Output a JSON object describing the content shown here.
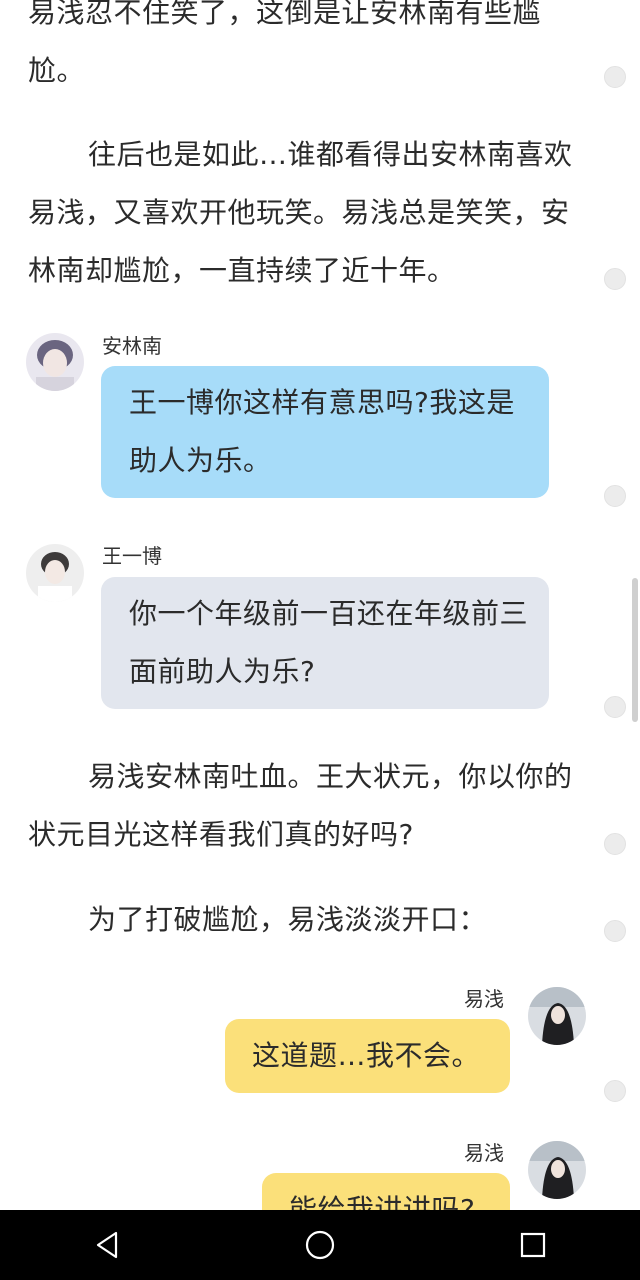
{
  "story": {
    "p1": "易浅忍不住笑了，这倒是让安林南有些尴尬。",
    "p2": "往后也是如此…谁都看得出安林南喜欢易浅，又喜欢开他玩笑。易浅总是笑笑，安林南却尴尬，一直持续了近十年。",
    "p3": "易浅安林南吐血。王大状元，你以你的状元目光这样看我们真的好吗?",
    "p4": "为了打破尴尬，易浅淡淡开口："
  },
  "chat": [
    {
      "name": "安林南",
      "text": "王一博你这样有意思吗?我这是助人为乐。"
    },
    {
      "name": "王一博",
      "text": "你一个年级前一百还在年级前三面前助人为乐?"
    },
    {
      "name": "易浅",
      "text": "这道题…我不会。"
    },
    {
      "name": "易浅",
      "text": "能给我讲讲吗?"
    }
  ],
  "nav": {
    "back": "back-icon",
    "home": "home-icon",
    "recent": "recent-apps-icon"
  },
  "colors": {
    "blue_bubble": "#a7dcf9",
    "gray_bubble": "#e2e6ee",
    "yellow_bubble": "#fbe07a"
  }
}
